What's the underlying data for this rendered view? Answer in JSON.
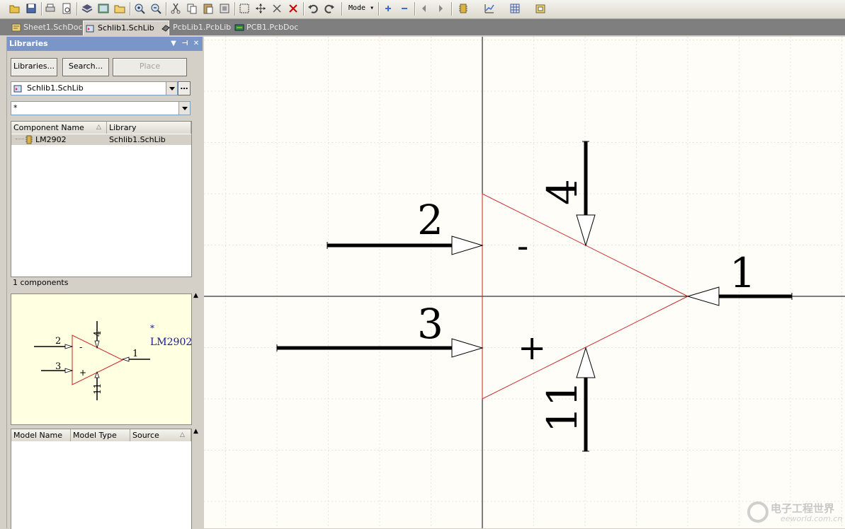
{
  "toolbar": {
    "mode_label": "Mode",
    "icons": [
      "open-folder-icon",
      "save-icon",
      "print-icon",
      "print-preview-icon",
      "layers-icon",
      "sheet-icon",
      "folder-icon",
      "zoom-in-icon",
      "zoom-out-icon",
      "cut-icon",
      "copy-icon",
      "paste-icon",
      "rubber-stamp-icon",
      "select-rect-icon",
      "move-icon",
      "cross-select-icon",
      "deselect-icon",
      "undo-icon",
      "redo-icon",
      "add-icon",
      "remove-icon",
      "back-icon",
      "forward-icon",
      "component-icon",
      "chart-icon",
      "grid-icon",
      "library-icon"
    ]
  },
  "tabs": [
    {
      "label": "Sheet1.SchDoc",
      "icon": "schdoc-icon"
    },
    {
      "label": "Schlib1.SchLib",
      "icon": "schlib-icon",
      "active": true
    },
    {
      "label": "PcbLib1.PcbLib",
      "icon": "pcblib-icon"
    },
    {
      "label": "PCB1.PcbDoc",
      "icon": "pcbdoc-icon"
    }
  ],
  "panel": {
    "title": "Libraries",
    "buttons": {
      "libraries": "Libraries...",
      "search": "Search...",
      "place": "Place"
    },
    "library_select": "Schlib1.SchLib",
    "filter_value": "*",
    "components_table": {
      "headers": [
        "Component Name",
        "Library"
      ],
      "rows": [
        {
          "name": "LM2902",
          "library": "Schlib1.SchLib"
        }
      ]
    },
    "component_count": "1 components",
    "preview": {
      "designator": "*",
      "comment": "LM2902",
      "pins": [
        "2",
        "4",
        "1",
        "3",
        "11"
      ],
      "minus": "-",
      "plus": "+"
    },
    "models_table": {
      "headers": [
        "Model Name",
        "Model Type",
        "Source"
      ]
    }
  },
  "schematic": {
    "pins": [
      {
        "number": "2"
      },
      {
        "number": "3"
      },
      {
        "number": "4"
      },
      {
        "number": "11"
      },
      {
        "number": "1"
      }
    ],
    "minus_sign": "-",
    "plus_sign": "+",
    "colors": {
      "body": "#cc2222",
      "pin": "#000000",
      "grid": "#e8e6de",
      "background": "#fefdf7"
    }
  },
  "watermark": {
    "text": "电子工程世界",
    "subtext": "eeworld.com.cn"
  }
}
